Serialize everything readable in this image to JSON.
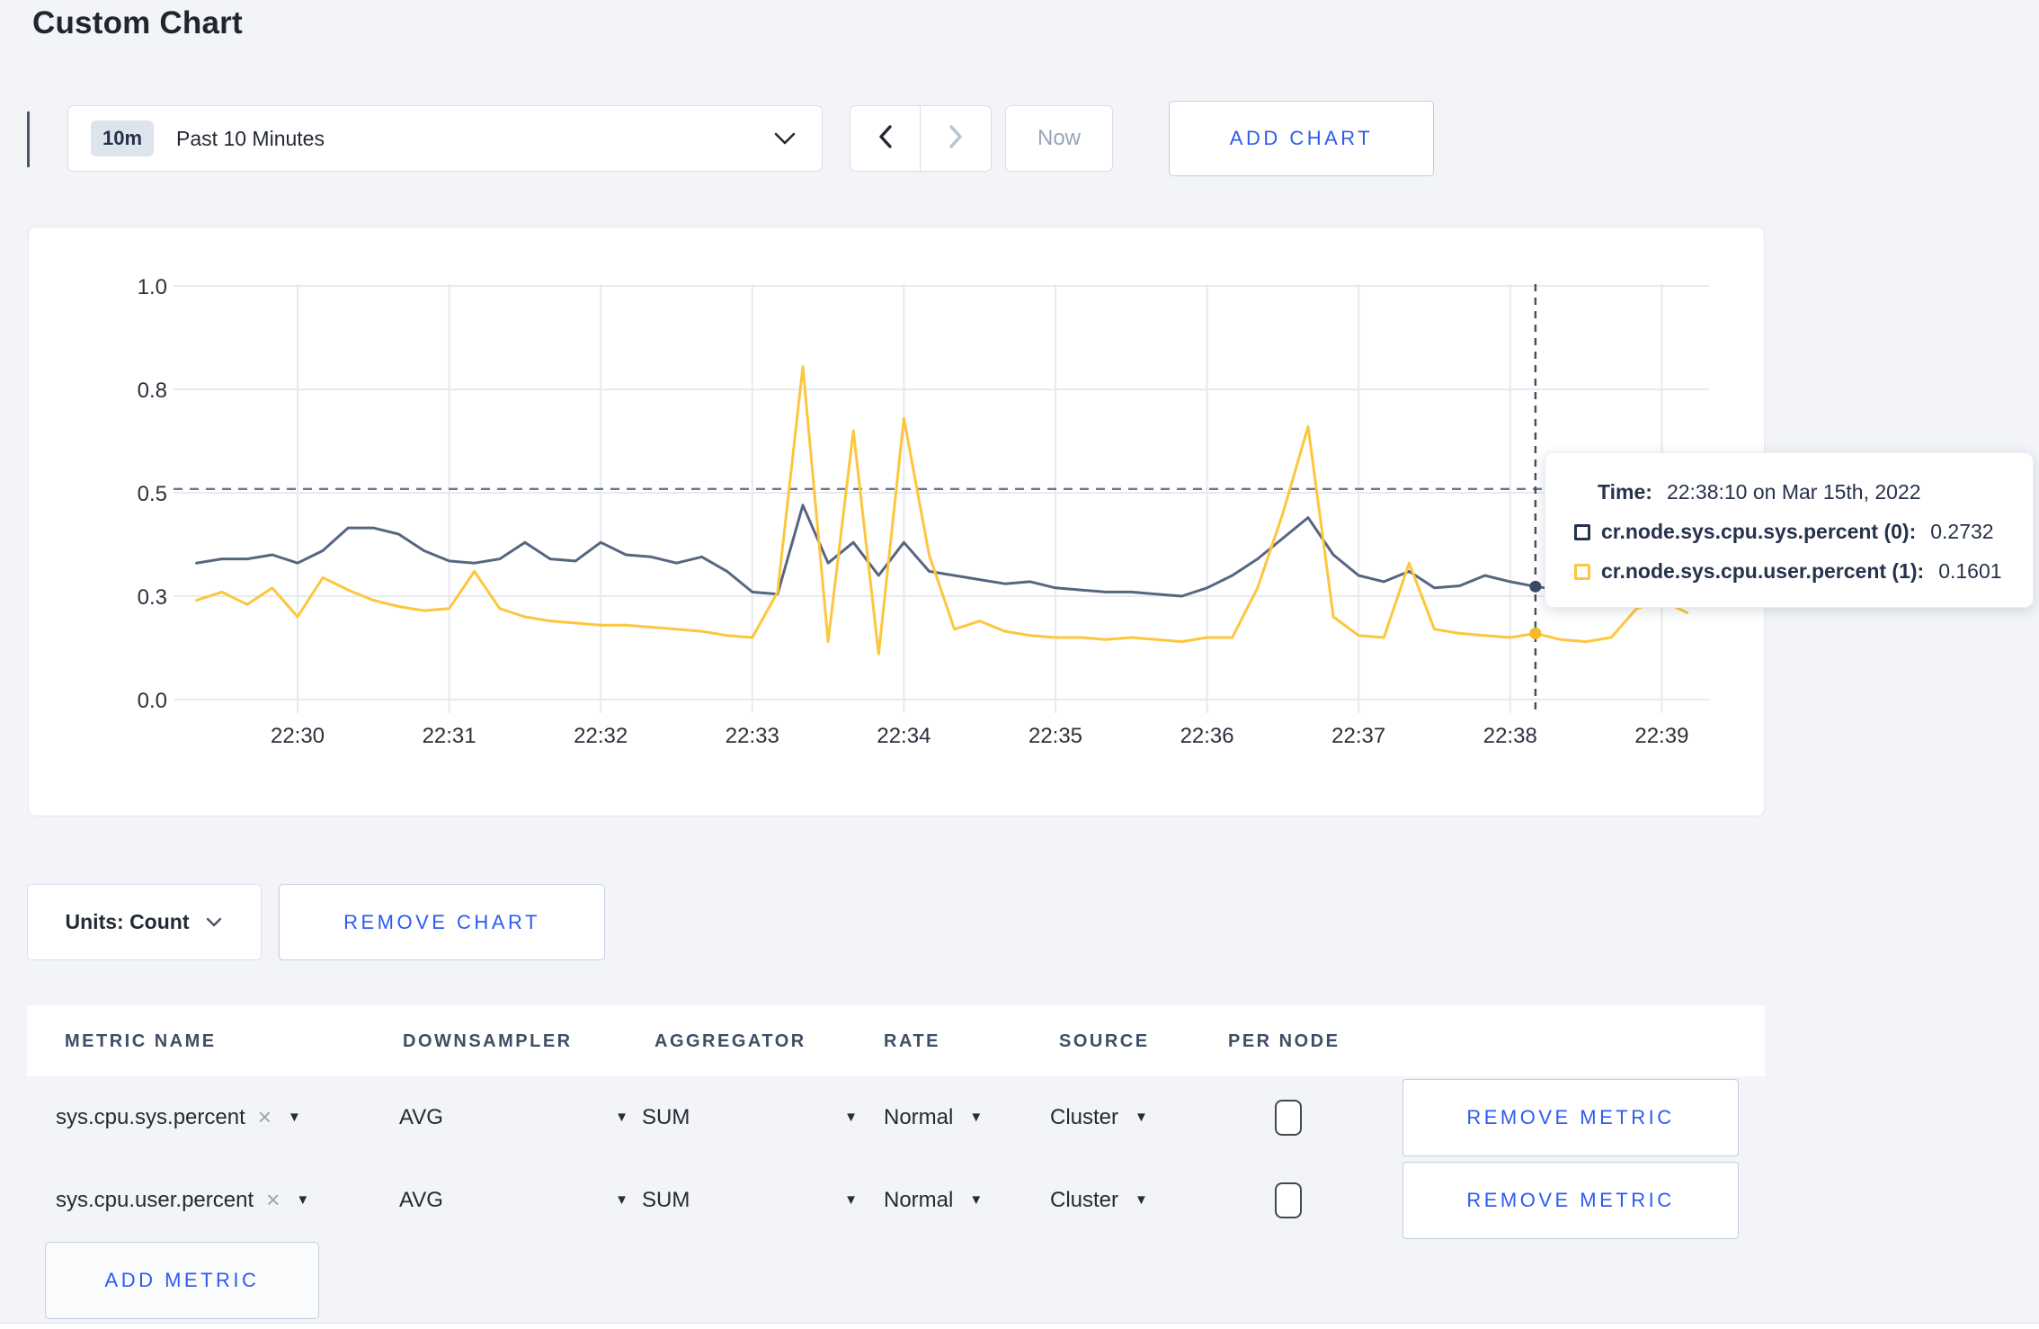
{
  "page": {
    "title": "Custom Chart",
    "background": "#f2f4f8",
    "accent_blue": "#2d5bf0"
  },
  "toolbar": {
    "time_window": {
      "badge": "10m",
      "label": "Past 10 Minutes"
    },
    "now_label": "Now",
    "add_chart_label": "ADD CHART"
  },
  "tooltip": {
    "time_label": "Time:",
    "time_value": "22:38:10 on Mar 15th, 2022",
    "series": [
      {
        "label": "cr.node.sys.cpu.sys.percent (0):",
        "value": "0.2732",
        "swatch_color": "#26324c"
      },
      {
        "label": "cr.node.sys.cpu.user.percent (1):",
        "value": "0.1601",
        "swatch_color": "#ffc53d"
      }
    ]
  },
  "chart_controls": {
    "units_label": "Units: Count",
    "remove_chart_label": "REMOVE CHART"
  },
  "metrics_table": {
    "headers": [
      "METRIC NAME",
      "DOWNSAMPLER",
      "AGGREGATOR",
      "RATE",
      "SOURCE",
      "PER NODE"
    ],
    "rows": [
      {
        "metric": "sys.cpu.sys.percent",
        "downsampler": "AVG",
        "aggregator": "SUM",
        "rate": "Normal",
        "source": "Cluster",
        "per_node_checked": false,
        "remove_label": "REMOVE METRIC"
      },
      {
        "metric": "sys.cpu.user.percent",
        "downsampler": "AVG",
        "aggregator": "SUM",
        "rate": "Normal",
        "source": "Cluster",
        "per_node_checked": false,
        "remove_label": "REMOVE METRIC"
      }
    ],
    "add_metric_label": "ADD METRIC"
  },
  "chart_data": {
    "type": "line",
    "title": "",
    "xlabel": "",
    "ylabel": "",
    "x_start_time": "22:29:20",
    "x_interval_seconds": 10,
    "x_tick_labels": [
      "22:30",
      "22:31",
      "22:32",
      "22:33",
      "22:34",
      "22:35",
      "22:36",
      "22:37",
      "22:38",
      "22:39"
    ],
    "y_ticks": {
      "values": [
        0,
        0.25,
        0.5,
        0.75,
        1.0
      ],
      "labels": [
        "0.0",
        "0.3",
        "0.5",
        "0.8",
        "1.0"
      ]
    },
    "ylim": [
      0,
      1
    ],
    "grid": true,
    "legend_position": "tooltip",
    "grid_color": "#e8eaf0",
    "series": [
      {
        "name": "cr.node.sys.cpu.sys.percent",
        "color": "#566681",
        "dot_color": "#3a4a68",
        "values": [
          0.33,
          0.34,
          0.34,
          0.35,
          0.33,
          0.36,
          0.415,
          0.415,
          0.4,
          0.36,
          0.335,
          0.33,
          0.34,
          0.38,
          0.34,
          0.335,
          0.38,
          0.35,
          0.345,
          0.33,
          0.345,
          0.31,
          0.26,
          0.255,
          0.47,
          0.33,
          0.38,
          0.3,
          0.38,
          0.31,
          0.3,
          0.29,
          0.28,
          0.285,
          0.27,
          0.265,
          0.26,
          0.26,
          0.255,
          0.25,
          0.27,
          0.3,
          0.34,
          0.39,
          0.44,
          0.35,
          0.3,
          0.285,
          0.31,
          0.27,
          0.275,
          0.3,
          0.285,
          0.2732,
          0.265,
          0.255,
          0.27,
          0.295,
          0.28,
          0.305
        ]
      },
      {
        "name": "cr.node.sys.cpu.user.percent",
        "color": "#fdc63d",
        "dot_color": "#f5b827",
        "values": [
          0.24,
          0.26,
          0.23,
          0.27,
          0.2,
          0.295,
          0.265,
          0.24,
          0.225,
          0.215,
          0.22,
          0.31,
          0.22,
          0.2,
          0.19,
          0.185,
          0.18,
          0.18,
          0.175,
          0.17,
          0.165,
          0.155,
          0.15,
          0.26,
          0.805,
          0.14,
          0.65,
          0.11,
          0.68,
          0.35,
          0.17,
          0.19,
          0.165,
          0.155,
          0.15,
          0.15,
          0.145,
          0.15,
          0.145,
          0.14,
          0.15,
          0.15,
          0.27,
          0.45,
          0.66,
          0.2,
          0.155,
          0.15,
          0.33,
          0.17,
          0.16,
          0.155,
          0.15,
          0.1601,
          0.145,
          0.14,
          0.15,
          0.22,
          0.24,
          0.21
        ]
      }
    ],
    "crosshair": {
      "x_index": 53,
      "time": "22:38:10",
      "hline_value": 0.509
    }
  }
}
